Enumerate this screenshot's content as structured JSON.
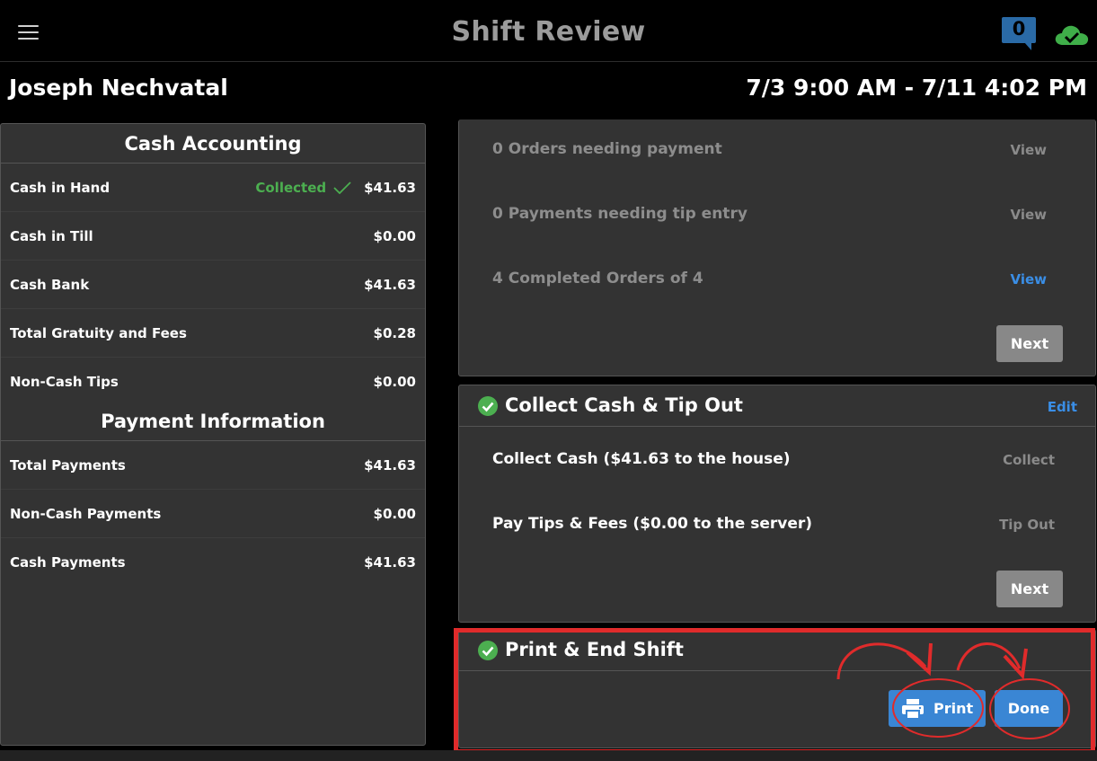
{
  "header": {
    "title": "Shift Review",
    "message_count": "0"
  },
  "shift": {
    "employee_name": "Joseph Nechvatal",
    "range": "7/3 9:00 AM - 7/11 4:02 PM"
  },
  "cash_accounting": {
    "title": "Cash Accounting",
    "rows": [
      {
        "label": "Cash in Hand",
        "status": "Collected",
        "value": "$41.63"
      },
      {
        "label": "Cash in Till",
        "value": "$0.00"
      },
      {
        "label": "Cash Bank",
        "value": "$41.63"
      },
      {
        "label": "Total Gratuity and Fees",
        "value": "$0.28"
      },
      {
        "label": "Non-Cash Tips",
        "value": "$0.00"
      }
    ]
  },
  "payment_information": {
    "title": "Payment Information",
    "rows": [
      {
        "label": "Total Payments",
        "value": "$41.63"
      },
      {
        "label": "Non-Cash Payments",
        "value": "$0.00"
      },
      {
        "label": "Cash Payments",
        "value": "$41.63"
      }
    ]
  },
  "orders_card": {
    "items": [
      {
        "label": "0 Orders needing payment",
        "action": "View"
      },
      {
        "label": "0 Payments needing tip entry",
        "action": "View"
      },
      {
        "label": "4 Completed Orders of 4",
        "action": "View"
      }
    ],
    "next_label": "Next"
  },
  "collect_card": {
    "title": "Collect Cash & Tip Out",
    "edit_label": "Edit",
    "items": [
      {
        "label": "Collect Cash ($41.63 to the house)",
        "action": "Collect"
      },
      {
        "label": "Pay Tips & Fees ($0.00 to the server)",
        "action": "Tip Out"
      }
    ],
    "next_label": "Next"
  },
  "end_card": {
    "title": "Print & End Shift",
    "print_label": "Print",
    "done_label": "Done"
  },
  "colors": {
    "accent_blue": "#3a86d4",
    "success_green": "#4caf50",
    "annotation_red": "#e02b2b"
  }
}
